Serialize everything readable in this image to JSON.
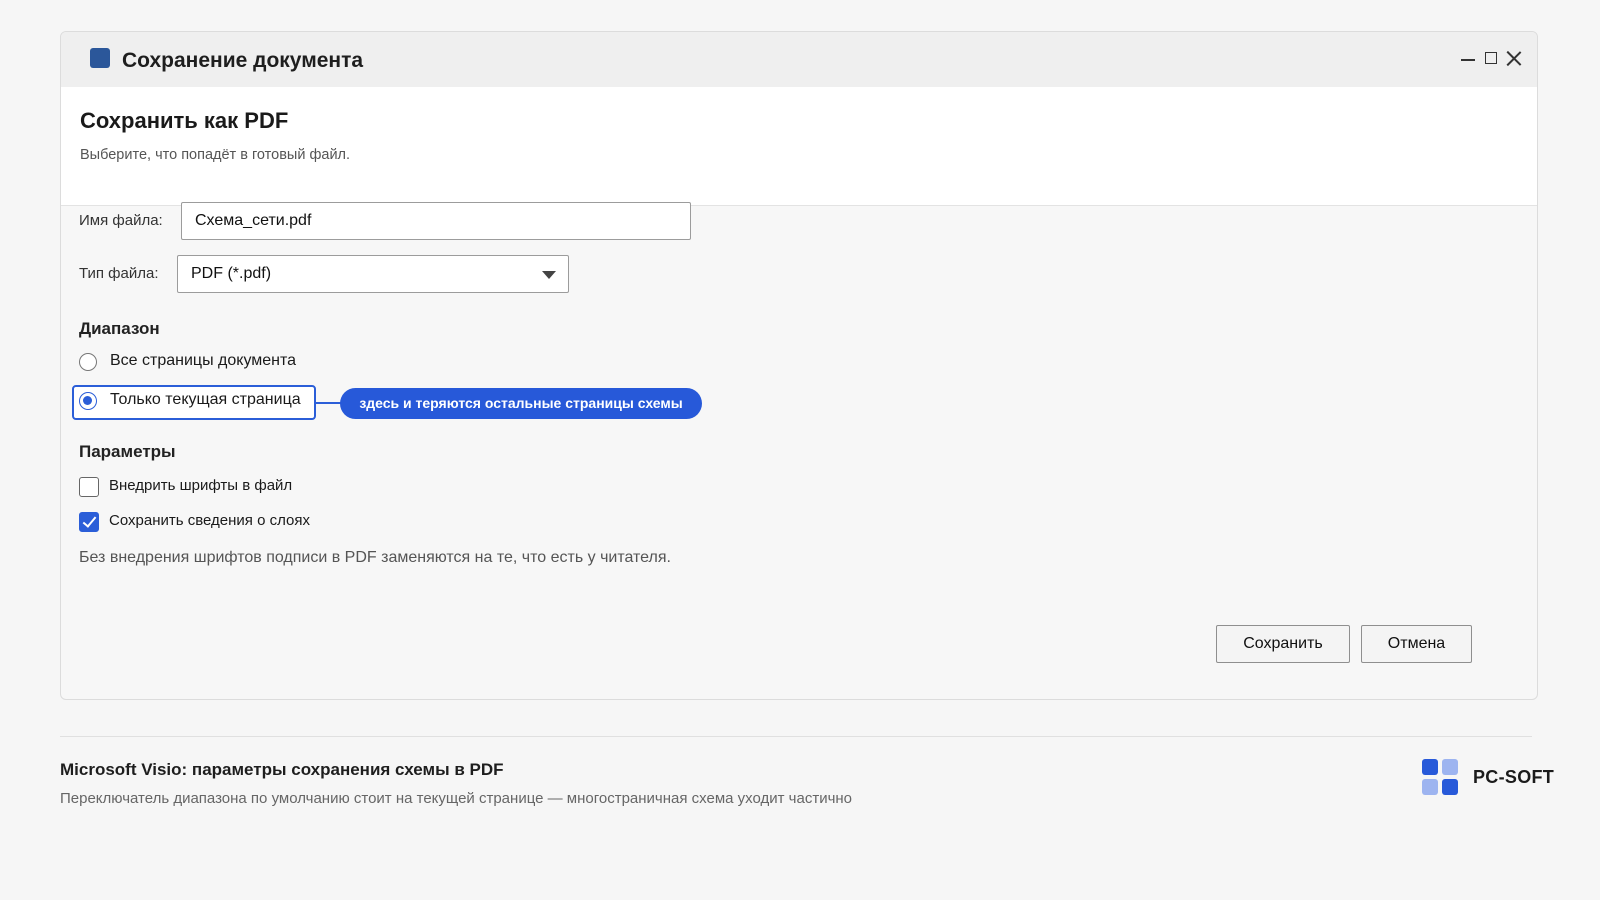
{
  "window": {
    "title": "Сохранение документа"
  },
  "header": {
    "title": "Сохранить как PDF",
    "subtitle": "Выберите, что попадёт в готовый файл."
  },
  "form": {
    "filename_label": "Имя файла:",
    "filename_value": "Схема_сети.pdf",
    "filetype_label": "Тип файла:",
    "filetype_value": "PDF (*.pdf)"
  },
  "range": {
    "heading": "Диапазон",
    "options": [
      {
        "label": "Все страницы документа",
        "selected": false
      },
      {
        "label": "Только текущая страница",
        "selected": true
      }
    ],
    "callout": "здесь и теряются остальные страницы схемы"
  },
  "params": {
    "heading": "Параметры",
    "options": [
      {
        "label": "Внедрить шрифты в файл",
        "checked": false
      },
      {
        "label": "Сохранить сведения о слоях",
        "checked": true
      }
    ],
    "note": "Без внедрения шрифтов подписи в PDF заменяются на те, что есть у читателя."
  },
  "buttons": {
    "save": "Сохранить",
    "cancel": "Отмена"
  },
  "caption": {
    "title": "Microsoft Visio: параметры сохранения схемы в PDF",
    "subtitle": "Переключатель диапазона по умолчанию стоит на текущей странице — многостраничная схема уходит частично"
  },
  "brand": {
    "name": "PC-SOFT",
    "colors": {
      "primary": "#2759d9",
      "light": "#9db4f0"
    }
  },
  "colors": {
    "accent": "#2b5ed8",
    "app_icon": "#2b579a"
  }
}
